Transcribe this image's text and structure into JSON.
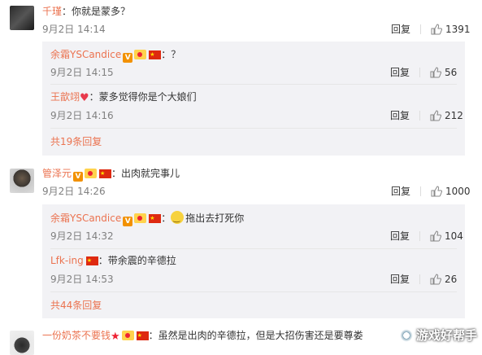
{
  "comments": [
    {
      "user": "千瑾",
      "text": "：你就是蒙多？",
      "time": "9月2日 14:14",
      "reply_label": "回复",
      "likes": "1391",
      "replies": [
        {
          "user": "余霜YSCandice",
          "text": "：？",
          "time": "9月2日 14:15",
          "reply_label": "回复",
          "likes": "56"
        },
        {
          "user": "王歆翊",
          "text": "：蒙多觉得你是个大娘们",
          "time": "9月2日 14:16",
          "reply_label": "回复",
          "likes": "212"
        }
      ],
      "more": "共19条回复"
    },
    {
      "user": "管泽元",
      "text": "：出肉就完事儿",
      "time": "9月2日 14:26",
      "reply_label": "回复",
      "likes": "1000",
      "replies": [
        {
          "user": "余霜YSCandice",
          "text": "拖出去打死你",
          "time": "9月2日 14:32",
          "reply_label": "回复",
          "likes": "104"
        },
        {
          "user": "Lfk-ing",
          "text": "：带余震的辛德拉",
          "time": "9月2日 14:53",
          "reply_label": "回复",
          "likes": "26"
        }
      ],
      "more": "共44条回复"
    },
    {
      "user": "一份奶茶不要钱",
      "text": "：虽然是出肉的辛德拉，但是大招伤害还是要尊娄"
    }
  ],
  "watermark": "游戏好帮手",
  "icons": {
    "like": "thumbs-up-icon",
    "verified": "v-badge-icon",
    "vip": "vip-badge-icon",
    "flag": "china-flag-icon",
    "heart": "heart-icon",
    "smiley": "smiley-emoji-icon",
    "star": "red-star-icon"
  },
  "colors": {
    "username": "#eb7350",
    "meta": "#808080",
    "reply_bg": "#f2f2f5"
  }
}
